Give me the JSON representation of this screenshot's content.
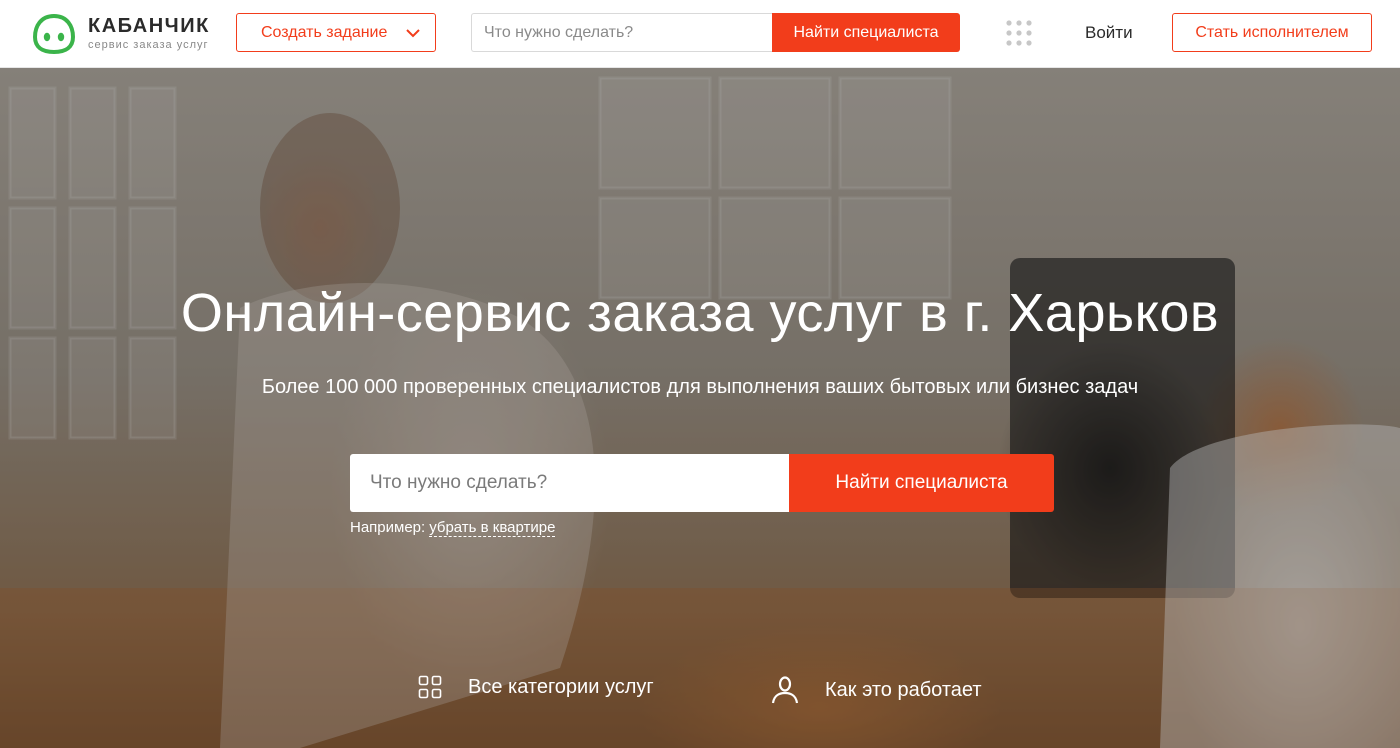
{
  "colors": {
    "accent": "#f23d1b",
    "logo_green": "#3bb44a",
    "text_dark": "#2b2b2b"
  },
  "header": {
    "logo": {
      "title": "КАБАНЧИК",
      "subtitle": "сервис заказа услуг",
      "icon": "pig-logo-icon"
    },
    "create_task_label": "Создать задание",
    "search": {
      "placeholder": "Что нужно сделать?",
      "value": ""
    },
    "find_label": "Найти специалиста",
    "apps_icon": "apps-grid-icon",
    "login_label": "Войти",
    "become_label": "Стать исполнителем"
  },
  "hero": {
    "title": "Онлайн-сервис заказа услуг в г. Харьков",
    "subtitle": "Более 100 000 проверенных специалистов для выполнения ваших бытовых или бизнес задач",
    "search": {
      "placeholder": "Что нужно сделать?",
      "value": ""
    },
    "find_label": "Найти специалиста",
    "example_prefix": "Например:",
    "example_link": "убрать в квартире",
    "links": [
      {
        "label": "Все категории услуг",
        "icon": "categories-grid-icon"
      },
      {
        "label": "Как это работает",
        "icon": "user-icon"
      }
    ]
  }
}
